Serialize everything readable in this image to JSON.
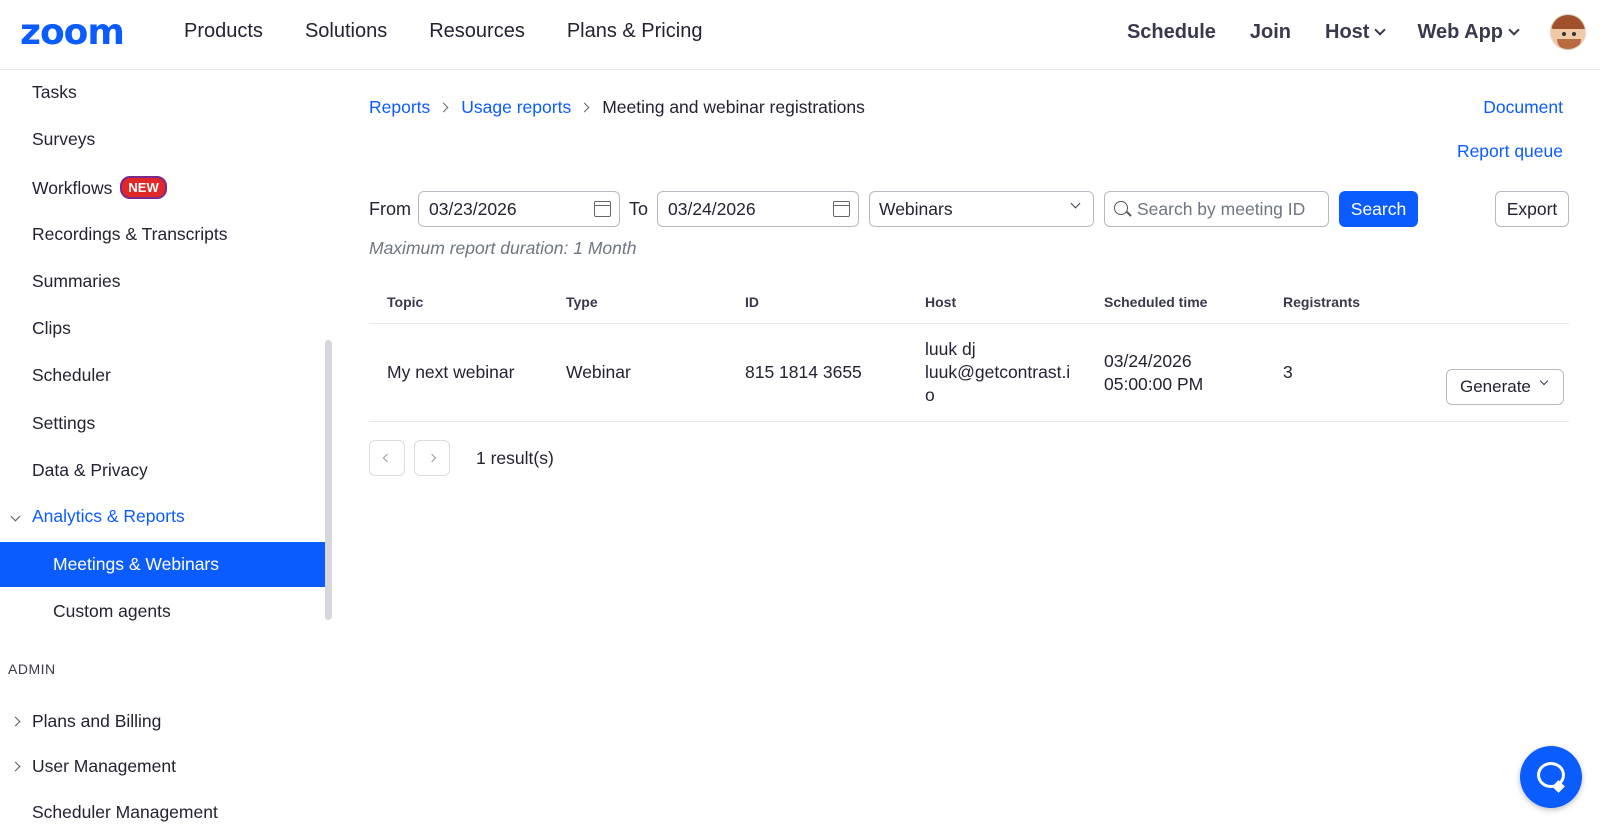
{
  "header": {
    "logo": "zoom",
    "nav_left": [
      "Products",
      "Solutions",
      "Resources",
      "Plans & Pricing"
    ],
    "schedule": "Schedule",
    "join": "Join",
    "host": "Host",
    "web_app": "Web App"
  },
  "sidebar": {
    "items": {
      "tasks": "Tasks",
      "surveys": "Surveys",
      "workflows": "Workflows",
      "workflows_badge": "NEW",
      "recordings": "Recordings & Transcripts",
      "summaries": "Summaries",
      "clips": "Clips",
      "scheduler": "Scheduler",
      "settings": "Settings",
      "data_privacy": "Data & Privacy",
      "analytics_reports": "Analytics & Reports",
      "meetings_webinars": "Meetings & Webinars",
      "custom_agents": "Custom agents"
    },
    "admin_label": "ADMIN",
    "admin_items": {
      "plans_billing": "Plans and Billing",
      "user_management": "User Management",
      "scheduler_management": "Scheduler Management"
    }
  },
  "breadcrumb": {
    "reports": "Reports",
    "usage_reports": "Usage reports",
    "current": "Meeting and webinar registrations"
  },
  "links": {
    "document": "Document",
    "report_queue": "Report queue"
  },
  "filters": {
    "from_label": "From",
    "from_date": "03/23/2026",
    "to_label": "To",
    "to_date": "03/24/2026",
    "type_selected": "Webinars",
    "search_placeholder": "Search by meeting ID",
    "search_button": "Search",
    "export_button": "Export"
  },
  "note": "Maximum report duration: 1 Month",
  "table": {
    "headers": {
      "topic": "Topic",
      "type": "Type",
      "id": "ID",
      "host": "Host",
      "scheduled_time": "Scheduled time",
      "registrants": "Registrants"
    },
    "rows": [
      {
        "topic": "My next webinar",
        "type": "Webinar",
        "id": "815 1814 3655",
        "host_name": "luuk dj",
        "host_email_1": "luuk@getcontrast.i",
        "host_email_2": "o",
        "scheduled_date": "03/24/2026",
        "scheduled_time": "05:00:00 PM",
        "registrants": "3",
        "action": "Generate"
      }
    ]
  },
  "pagination": {
    "result_count": "1 result(s)"
  },
  "colors": {
    "brand": "#0b5cff",
    "badge": "#e02828"
  }
}
